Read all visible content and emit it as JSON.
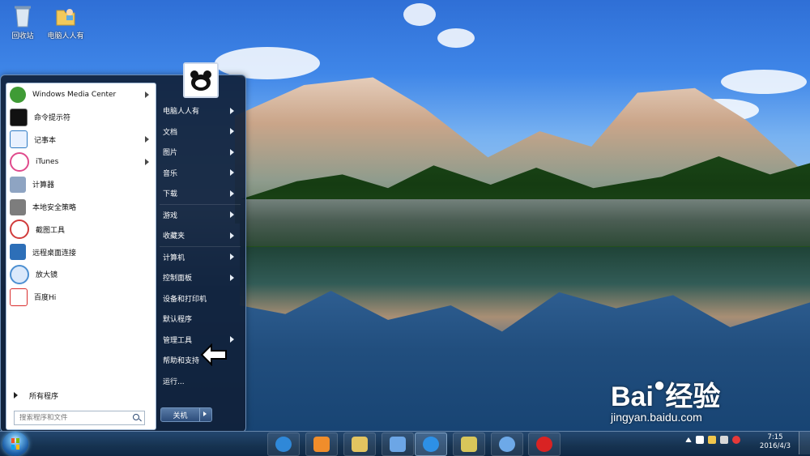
{
  "desktop": {
    "icons": [
      {
        "label": "回收站",
        "icon": "recycle-bin-icon"
      },
      {
        "label": "电脑人人有",
        "icon": "user-folder-icon"
      }
    ]
  },
  "watermark": {
    "brand": "Bai",
    "brand_suffix": "经验",
    "url": "jingyan.baidu.com"
  },
  "start_menu": {
    "left_items": [
      {
        "label": "Windows Media Center",
        "icon": "media-center-icon",
        "submenu": true,
        "color": "#3f9b35"
      },
      {
        "label": "命令提示符",
        "icon": "command-prompt-icon",
        "submenu": false,
        "color": "#111111"
      },
      {
        "label": "记事本",
        "icon": "notepad-icon",
        "submenu": true,
        "color": "#2e7bc4"
      },
      {
        "label": "iTunes",
        "icon": "itunes-icon",
        "submenu": true,
        "color": "#e04a8c"
      },
      {
        "label": "计算器",
        "icon": "calculator-icon",
        "submenu": false,
        "color": "#8ea4c2"
      },
      {
        "label": "本地安全策略",
        "icon": "security-policy-icon",
        "submenu": false,
        "color": "#777777"
      },
      {
        "label": "截图工具",
        "icon": "snipping-tool-icon",
        "submenu": false,
        "color": "#d13c3c"
      },
      {
        "label": "远程桌面连接",
        "icon": "remote-desktop-icon",
        "submenu": false,
        "color": "#2d6fb8"
      },
      {
        "label": "放大镜",
        "icon": "magnifier-icon",
        "submenu": false,
        "color": "#4c8fd1"
      },
      {
        "label": "百度Hi",
        "icon": "baidu-hi-icon",
        "submenu": false,
        "color": "#d92d2d"
      }
    ],
    "all_programs": "所有程序",
    "search_placeholder": "搜索程序和文件",
    "right_items": [
      {
        "label": "电脑人人有",
        "submenu": true
      },
      {
        "label": "文档",
        "submenu": true
      },
      {
        "label": "图片",
        "submenu": true
      },
      {
        "label": "音乐",
        "submenu": true
      },
      {
        "label": "下载",
        "submenu": true
      },
      {
        "label": "游戏",
        "submenu": true
      },
      {
        "label": "收藏夹",
        "submenu": true
      },
      {
        "label": "计算机",
        "submenu": true
      },
      {
        "label": "控制面板",
        "submenu": true
      },
      {
        "label": "设备和打印机",
        "submenu": false
      },
      {
        "label": "默认程序",
        "submenu": false
      },
      {
        "label": "管理工具",
        "submenu": true
      },
      {
        "label": "帮助和支持",
        "submenu": false
      },
      {
        "label": "运行...",
        "submenu": false
      }
    ],
    "shutdown": "关机"
  },
  "taskbar": {
    "apps": [
      {
        "name": "internet-explorer",
        "color": "#2f88d8",
        "active": false
      },
      {
        "name": "media-player",
        "color": "#f08d2b",
        "active": false
      },
      {
        "name": "file-explorer",
        "color": "#e3c460",
        "active": false
      },
      {
        "name": "remote-desktop",
        "color": "#6ca6e6",
        "active": false
      },
      {
        "name": "sogou-input",
        "color": "#2d90e6",
        "active": true
      },
      {
        "name": "folder-shortcut",
        "color": "#d8c65a",
        "active": false
      },
      {
        "name": "paint",
        "color": "#6da9e8",
        "active": false
      },
      {
        "name": "chess-game",
        "color": "#d92323",
        "active": false
      }
    ],
    "tray": [
      {
        "name": "show-hidden-icon",
        "color": "#ffffff"
      },
      {
        "name": "flag-icon",
        "color": "#ffffff"
      },
      {
        "name": "network-icon",
        "color": "#f0c64c"
      },
      {
        "name": "volume-icon",
        "color": "#d8d8d8"
      },
      {
        "name": "antivirus-icon",
        "color": "#e63939"
      }
    ],
    "time": "7:15",
    "date": "2016/4/3"
  }
}
